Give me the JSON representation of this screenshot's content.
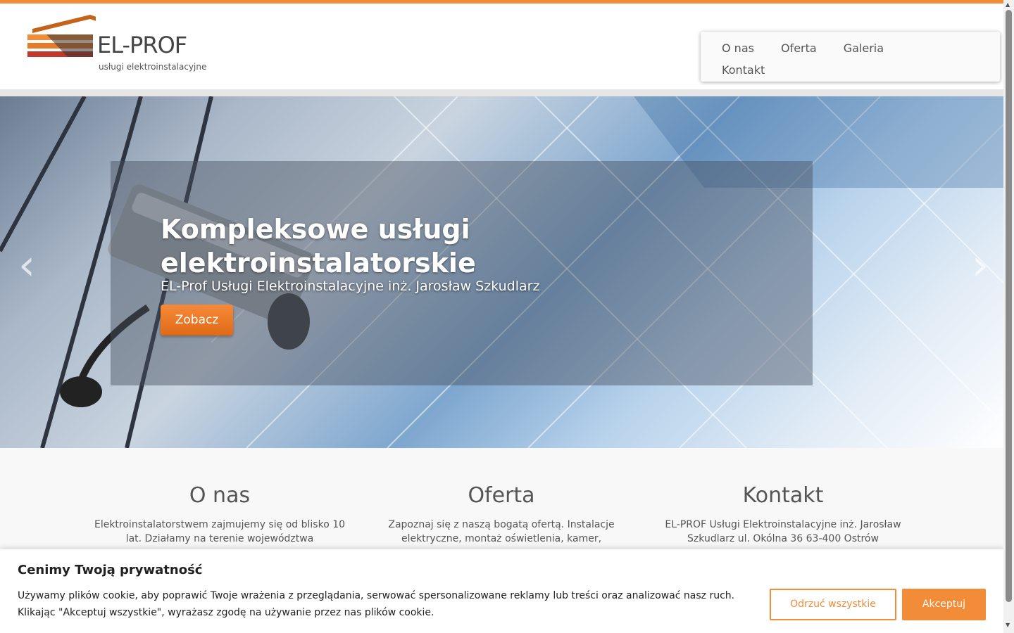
{
  "logo": {
    "name": "EL-PROF",
    "tagline": "usługi elektroinstalacyjne"
  },
  "nav": {
    "items": [
      "O nas",
      "Oferta",
      "Galeria",
      "Kontakt"
    ]
  },
  "hero": {
    "title": "Kompleksowe usługi elektroinstalatorskie",
    "subtitle": "EL-Prof Usługi Elektroinstalacyjne inż. Jarosław Szkudlarz",
    "button": "Zobacz",
    "prev": "‹",
    "next": "›"
  },
  "columns": [
    {
      "title": "O nas",
      "text": "Elektroinstalatorstwem zajmujemy się od blisko 10 lat. Działamy na terenie województwa"
    },
    {
      "title": "Oferta",
      "text": "Zapoznaj się z naszą bogatą ofertą. Instalacje elektryczne, montaż oświetlenia, kamer,"
    },
    {
      "title": "Kontakt",
      "text": "EL-PROF Usługi Elektroinstalacyjne inż. Jarosław Szkudlarz ul. Okólna 36 63-400 Ostrów"
    }
  ],
  "cookie": {
    "title": "Cenimy Twoją prywatność",
    "text": "Używamy plików cookie, aby poprawić Twoje wrażenia z przeglądania, serwować spersonalizowane reklamy lub treści oraz analizować nasz ruch. Klikając \"Akceptuj wszystkie\", wyrażasz zgodę na używanie przez nas plików cookie.",
    "reject": "Odrzuć wszystkie",
    "accept": "Akceptuj"
  },
  "colors": {
    "accent": "#f28c38",
    "text": "#555555"
  }
}
